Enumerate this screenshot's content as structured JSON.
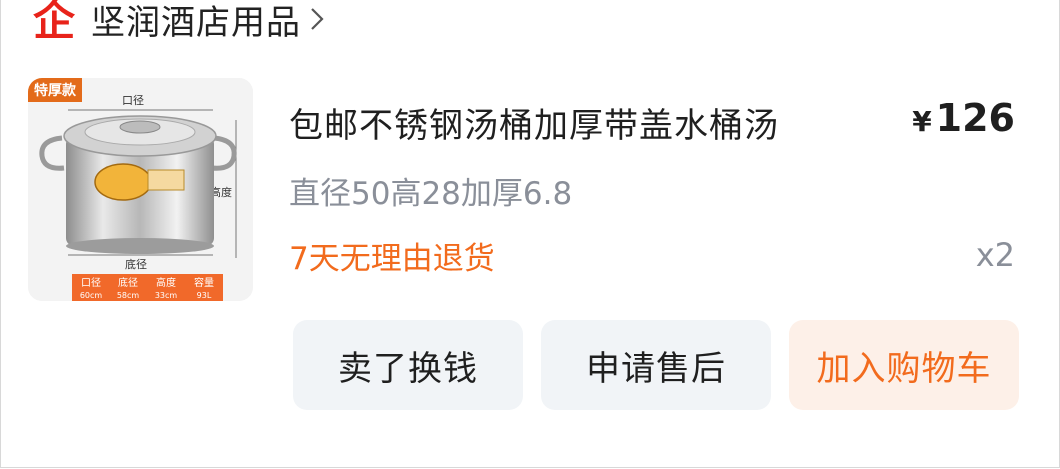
{
  "store": {
    "logo_text": "企",
    "name": "坚润酒店用品"
  },
  "product": {
    "image_labels": {
      "badge": "特厚款",
      "diameter": "口径",
      "height": "高度",
      "bottom": "底径",
      "table_headers": [
        "口径",
        "底径",
        "高度",
        "容量"
      ],
      "table_values": [
        "60cm",
        "58cm",
        "33cm",
        "93L"
      ]
    },
    "title": "包邮不锈钢汤桶加厚带盖水桶汤",
    "currency": "¥",
    "price": "126",
    "spec": "直径50高28加厚6.8",
    "promise": "7天无理由退货",
    "quantity": "x2"
  },
  "actions": {
    "sell": "卖了换钱",
    "after_sale": "申请售后",
    "add_cart": "加入购物车"
  },
  "colors": {
    "accent": "#f26b1d",
    "logo": "#e8231a",
    "button_bg": "#f1f4f7",
    "cart_bg": "#fdf0e8"
  }
}
